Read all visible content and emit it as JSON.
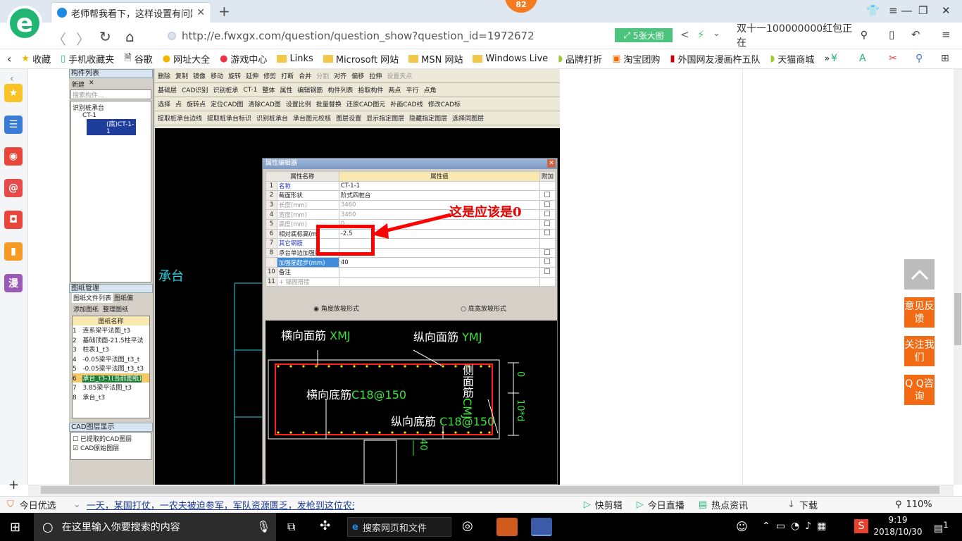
{
  "browser": {
    "tab_title": "老师帮我看下，这样设置有问题",
    "badge": "82",
    "url": "http://e.fwxgx.com/question/question_show?question_id=1972672",
    "image_button": "5张大图",
    "search_text": "双十一100000000红包正在"
  },
  "bookmarks": [
    "收藏",
    "手机收藏夹",
    "谷歌",
    "网址大全",
    "游戏中心",
    "Links",
    "Microsoft 网站",
    "MSN 网站",
    "Windows Live",
    "品牌打折",
    "淘宝团购",
    "外国网友漫画杵五队",
    "天猫商城"
  ],
  "software": {
    "component_list_title": "构件列表",
    "new_button": "新建",
    "search_placeholder": "搜索构件...",
    "tree": [
      "识别桩承台",
      "CT-1",
      "(底)CT-1-1"
    ],
    "drawing_mgmt_title": "图纸管理",
    "drawing_tabs": [
      "图纸文件列表",
      "图纸偏"
    ],
    "drawing_buttons": [
      "添加图纸",
      "整理图纸"
    ],
    "drawing_col": "图纸名称",
    "drawings": [
      "连系梁平法图_t3",
      "基础顶面-21.5柱平法",
      "柱表1_t3",
      "-0.05梁平法图_t3_t",
      "-0.05梁平法图_t3_t3",
      "承台_t3-1(当前图纸)",
      "3.85梁平法图_t3",
      "承台_t3"
    ],
    "cad_layer_title": "CAD图层显示",
    "cad_layers": [
      "已提取的CAD图层",
      "CAD原始图层"
    ],
    "toolbar_row1": [
      "删除",
      "复制",
      "镜像",
      "移动",
      "旋转",
      "延伸",
      "修剪",
      "打断",
      "合并",
      "分割",
      "对齐",
      "偏移",
      "拉伸",
      "设置夹点"
    ],
    "toolbar_row2": [
      "基础层",
      "CAD识别",
      "识别桩承",
      "CT-1",
      "整体",
      "属性",
      "编辑钢筋",
      "构件列表",
      "拾取构件",
      "两点",
      "平行",
      "点角"
    ],
    "toolbar_row3": [
      "选择",
      "点",
      "旋转点",
      "定位CAD图",
      "清除CAD图",
      "设置比例",
      "批量替换",
      "还原CAD图元",
      "补画CAD线",
      "修改CAD标"
    ],
    "toolbar_row4": [
      "提取桩承台边线",
      "提取桩承台标识",
      "识别桩承台",
      "承台图元校核",
      "图层设置",
      "显示指定图层",
      "隐藏指定图层",
      "选择同图层"
    ],
    "cad_label": "承台"
  },
  "dialog": {
    "title": "属性编辑器",
    "headers": [
      "属性名称",
      "属性值",
      "附加"
    ],
    "rows": [
      {
        "n": "1",
        "name": "名称",
        "value": "CT-1-1"
      },
      {
        "n": "2",
        "name": "截面形状",
        "value": "阶式四桩台"
      },
      {
        "n": "3",
        "name": "长度(mm)",
        "value": "3460"
      },
      {
        "n": "4",
        "name": "宽度(mm)",
        "value": "3460"
      },
      {
        "n": "5",
        "name": "高度(mm)",
        "value": "0"
      },
      {
        "n": "6",
        "name": "相对底标高(m)",
        "value": "-2.5"
      },
      {
        "n": "7",
        "name": "其它钢筋",
        "value": ""
      },
      {
        "n": "8",
        "name": "承台单边加强筋",
        "value": ""
      },
      {
        "n": "9",
        "name": "加强筋起步(mm)",
        "value": "40"
      },
      {
        "n": "10",
        "name": "备注",
        "value": ""
      },
      {
        "n": "11",
        "name": "+ 锚固搭接",
        "value": ""
      }
    ],
    "radio1": "角度放坡形式",
    "radio2": "底宽放坡形式",
    "cad": {
      "top_h": "横向面筋",
      "top_h_code": "XMJ",
      "top_v": "纵向面筋",
      "top_v_code": "YMJ",
      "bot_h": "横向底筋",
      "bot_h_code": "C18@150",
      "bot_v": "纵向底筋",
      "bot_v_code": "C18@150",
      "side": "侧面筋",
      "side_code": "CMJ",
      "dim0": "0",
      "dim10d": "10*d",
      "dim40": "40"
    }
  },
  "annotation": "这是应该是0",
  "float_buttons": [
    "意见反馈",
    "关注我们",
    "Q Q咨询"
  ],
  "status": {
    "today": "今日优选",
    "news": "一天，某国打仗，一农夫被迫参军，军队资源匮乏，发枪到这位农夫...",
    "items": [
      "快剪辑",
      "今日直播",
      "热点资讯",
      "下载"
    ],
    "zoom": "110%"
  },
  "taskbar": {
    "search_placeholder": "在这里输入你要搜索的内容",
    "browser_search": "搜索网页和文件",
    "time": "9:19",
    "date": "2018/10/30",
    "notif": "1"
  }
}
